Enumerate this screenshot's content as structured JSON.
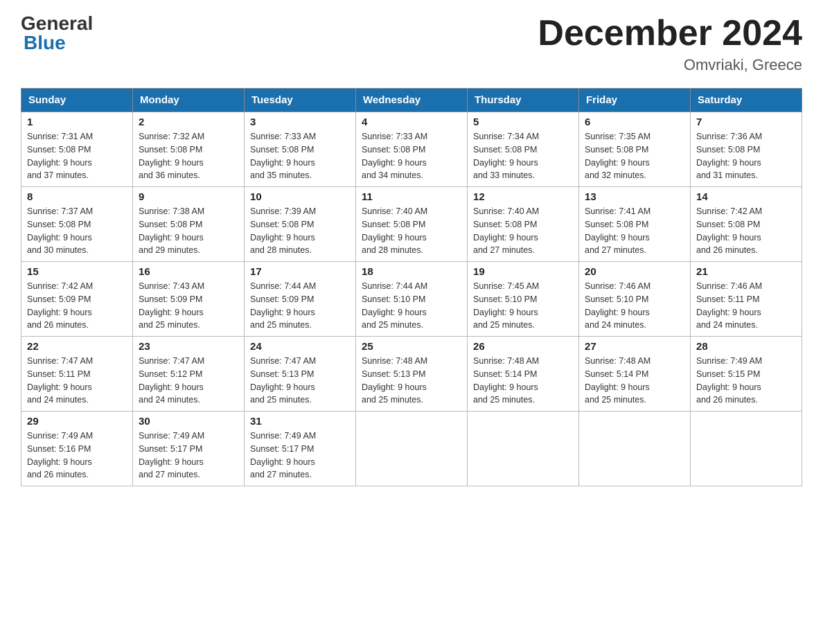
{
  "header": {
    "logo_general": "General",
    "logo_blue": "Blue",
    "title": "December 2024",
    "subtitle": "Omvriaki, Greece"
  },
  "days_of_week": [
    "Sunday",
    "Monday",
    "Tuesday",
    "Wednesday",
    "Thursday",
    "Friday",
    "Saturday"
  ],
  "weeks": [
    [
      {
        "day": "1",
        "sunrise": "7:31 AM",
        "sunset": "5:08 PM",
        "daylight": "9 hours and 37 minutes."
      },
      {
        "day": "2",
        "sunrise": "7:32 AM",
        "sunset": "5:08 PM",
        "daylight": "9 hours and 36 minutes."
      },
      {
        "day": "3",
        "sunrise": "7:33 AM",
        "sunset": "5:08 PM",
        "daylight": "9 hours and 35 minutes."
      },
      {
        "day": "4",
        "sunrise": "7:33 AM",
        "sunset": "5:08 PM",
        "daylight": "9 hours and 34 minutes."
      },
      {
        "day": "5",
        "sunrise": "7:34 AM",
        "sunset": "5:08 PM",
        "daylight": "9 hours and 33 minutes."
      },
      {
        "day": "6",
        "sunrise": "7:35 AM",
        "sunset": "5:08 PM",
        "daylight": "9 hours and 32 minutes."
      },
      {
        "day": "7",
        "sunrise": "7:36 AM",
        "sunset": "5:08 PM",
        "daylight": "9 hours and 31 minutes."
      }
    ],
    [
      {
        "day": "8",
        "sunrise": "7:37 AM",
        "sunset": "5:08 PM",
        "daylight": "9 hours and 30 minutes."
      },
      {
        "day": "9",
        "sunrise": "7:38 AM",
        "sunset": "5:08 PM",
        "daylight": "9 hours and 29 minutes."
      },
      {
        "day": "10",
        "sunrise": "7:39 AM",
        "sunset": "5:08 PM",
        "daylight": "9 hours and 28 minutes."
      },
      {
        "day": "11",
        "sunrise": "7:40 AM",
        "sunset": "5:08 PM",
        "daylight": "9 hours and 28 minutes."
      },
      {
        "day": "12",
        "sunrise": "7:40 AM",
        "sunset": "5:08 PM",
        "daylight": "9 hours and 27 minutes."
      },
      {
        "day": "13",
        "sunrise": "7:41 AM",
        "sunset": "5:08 PM",
        "daylight": "9 hours and 27 minutes."
      },
      {
        "day": "14",
        "sunrise": "7:42 AM",
        "sunset": "5:08 PM",
        "daylight": "9 hours and 26 minutes."
      }
    ],
    [
      {
        "day": "15",
        "sunrise": "7:42 AM",
        "sunset": "5:09 PM",
        "daylight": "9 hours and 26 minutes."
      },
      {
        "day": "16",
        "sunrise": "7:43 AM",
        "sunset": "5:09 PM",
        "daylight": "9 hours and 25 minutes."
      },
      {
        "day": "17",
        "sunrise": "7:44 AM",
        "sunset": "5:09 PM",
        "daylight": "9 hours and 25 minutes."
      },
      {
        "day": "18",
        "sunrise": "7:44 AM",
        "sunset": "5:10 PM",
        "daylight": "9 hours and 25 minutes."
      },
      {
        "day": "19",
        "sunrise": "7:45 AM",
        "sunset": "5:10 PM",
        "daylight": "9 hours and 25 minutes."
      },
      {
        "day": "20",
        "sunrise": "7:46 AM",
        "sunset": "5:10 PM",
        "daylight": "9 hours and 24 minutes."
      },
      {
        "day": "21",
        "sunrise": "7:46 AM",
        "sunset": "5:11 PM",
        "daylight": "9 hours and 24 minutes."
      }
    ],
    [
      {
        "day": "22",
        "sunrise": "7:47 AM",
        "sunset": "5:11 PM",
        "daylight": "9 hours and 24 minutes."
      },
      {
        "day": "23",
        "sunrise": "7:47 AM",
        "sunset": "5:12 PM",
        "daylight": "9 hours and 24 minutes."
      },
      {
        "day": "24",
        "sunrise": "7:47 AM",
        "sunset": "5:13 PM",
        "daylight": "9 hours and 25 minutes."
      },
      {
        "day": "25",
        "sunrise": "7:48 AM",
        "sunset": "5:13 PM",
        "daylight": "9 hours and 25 minutes."
      },
      {
        "day": "26",
        "sunrise": "7:48 AM",
        "sunset": "5:14 PM",
        "daylight": "9 hours and 25 minutes."
      },
      {
        "day": "27",
        "sunrise": "7:48 AM",
        "sunset": "5:14 PM",
        "daylight": "9 hours and 25 minutes."
      },
      {
        "day": "28",
        "sunrise": "7:49 AM",
        "sunset": "5:15 PM",
        "daylight": "9 hours and 26 minutes."
      }
    ],
    [
      {
        "day": "29",
        "sunrise": "7:49 AM",
        "sunset": "5:16 PM",
        "daylight": "9 hours and 26 minutes."
      },
      {
        "day": "30",
        "sunrise": "7:49 AM",
        "sunset": "5:17 PM",
        "daylight": "9 hours and 27 minutes."
      },
      {
        "day": "31",
        "sunrise": "7:49 AM",
        "sunset": "5:17 PM",
        "daylight": "9 hours and 27 minutes."
      },
      null,
      null,
      null,
      null
    ]
  ],
  "labels": {
    "sunrise": "Sunrise:",
    "sunset": "Sunset:",
    "daylight": "Daylight:"
  }
}
